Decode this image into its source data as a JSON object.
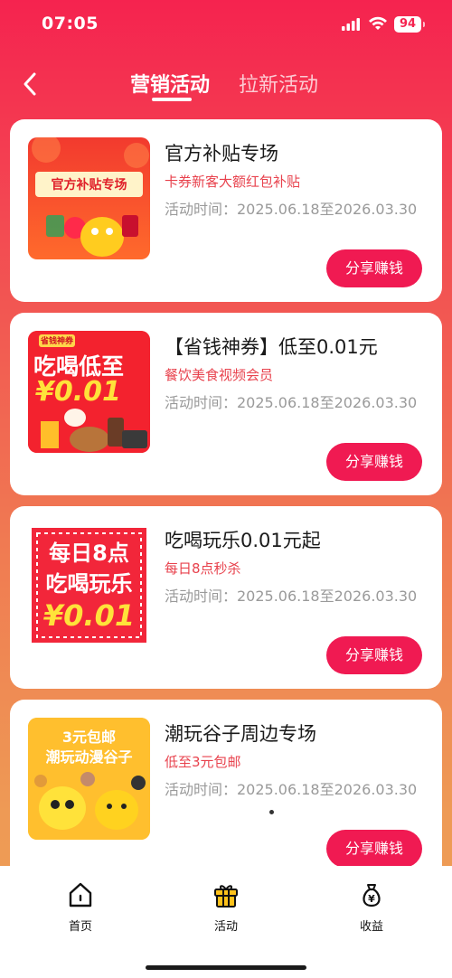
{
  "status": {
    "time": "07:05",
    "battery": "94"
  },
  "nav": {
    "tabs": [
      "营销活动",
      "拉新活动"
    ]
  },
  "cards": [
    {
      "title": "官方补贴专场",
      "subtitle": "卡券新客大额红包补贴",
      "period": "活动时间：2025.06.18至2026.03.30",
      "share": "分享赚钱",
      "thumb_text": "官方补贴专场"
    },
    {
      "title": "【省钱神券】低至0.01元",
      "subtitle": "餐饮美食视频会员",
      "period": "活动时间：2025.06.18至2026.03.30",
      "share": "分享赚钱",
      "thumb_tag": "省钱神券",
      "thumb_line1": "吃喝低至",
      "thumb_line2": "¥0.01"
    },
    {
      "title": "吃喝玩乐0.01元起",
      "subtitle": "每日8点秒杀",
      "period": "活动时间：2025.06.18至2026.03.30",
      "share": "分享赚钱",
      "thumb_line1": "每日8点",
      "thumb_line2": "吃喝玩乐",
      "thumb_line3": "¥0.01"
    },
    {
      "title": "潮玩谷子周边专场",
      "subtitle": "低至3元包邮",
      "period": "活动时间：2025.06.18至2026.03.30",
      "share": "分享赚钱",
      "thumb_line1": "3元包邮",
      "thumb_line2": "潮玩动漫谷子"
    }
  ],
  "tabbar": {
    "home": "首页",
    "activity": "活动",
    "earnings": "收益"
  },
  "colors": {
    "accent": "#f01a52",
    "subtitle": "#e8424d"
  }
}
